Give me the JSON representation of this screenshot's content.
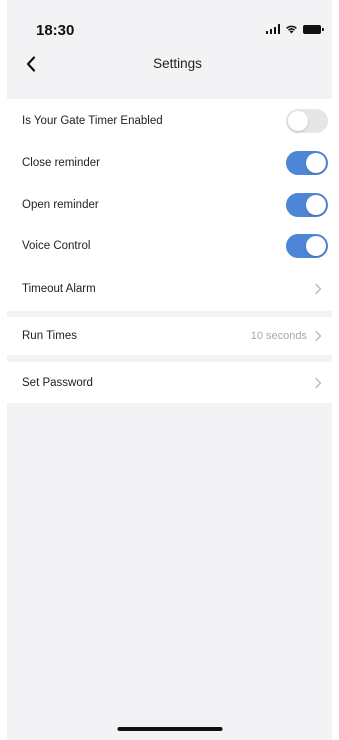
{
  "status_bar": {
    "time": "18:30"
  },
  "nav": {
    "title": "Settings",
    "back_icon": "chevron-left-icon"
  },
  "settings": {
    "gate_timer": {
      "label": "Is Your Gate Timer Enabled",
      "enabled": false
    },
    "close_reminder": {
      "label": "Close reminder",
      "enabled": true
    },
    "open_reminder": {
      "label": "Open reminder",
      "enabled": true
    },
    "voice_control": {
      "label": "Voice Control",
      "enabled": true
    },
    "timeout_alarm": {
      "label": "Timeout Alarm"
    },
    "run_times": {
      "label": "Run Times",
      "value": "10 seconds"
    },
    "set_password": {
      "label": "Set Password"
    }
  },
  "colors": {
    "toggle_on": "#4d86d6",
    "toggle_off": "#e6e6e9",
    "background": "#f3f3f5"
  }
}
